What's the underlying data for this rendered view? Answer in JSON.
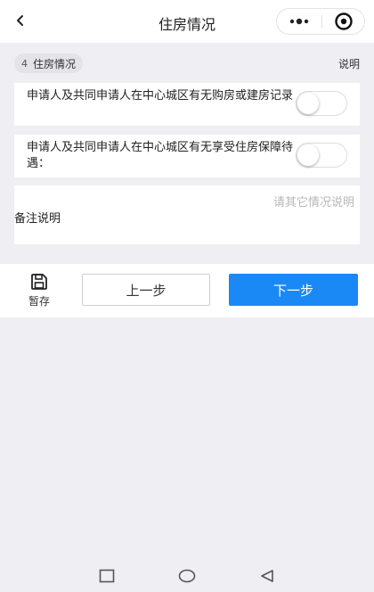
{
  "nav": {
    "title": "住房情况",
    "back_icon": "back-arrow-icon",
    "more_icon": "more-dots-icon",
    "eye_icon": "eye-icon"
  },
  "section": {
    "number": "4",
    "title": "住房情况",
    "action": "说明"
  },
  "questions": [
    {
      "text": "申请人及共同申请人在中心城区有无购房或建房记录",
      "enabled": false
    },
    {
      "text": "申请人及共同申请人在中心城区有无享受住房保障待遇：",
      "enabled": false
    }
  ],
  "note": {
    "label": "备注说明",
    "placeholder": "请其它情况说明",
    "value": ""
  },
  "bottom": {
    "save_label": "暂存",
    "prev_label": "上一步",
    "next_label": "下一步",
    "save_icon": "save-icon"
  },
  "system_nav": {
    "recent_icon": "recent-apps-icon",
    "home_icon": "home-icon",
    "back_icon": "system-back-icon"
  },
  "colors": {
    "accent": "#1a89f5",
    "background": "#efeff3"
  }
}
